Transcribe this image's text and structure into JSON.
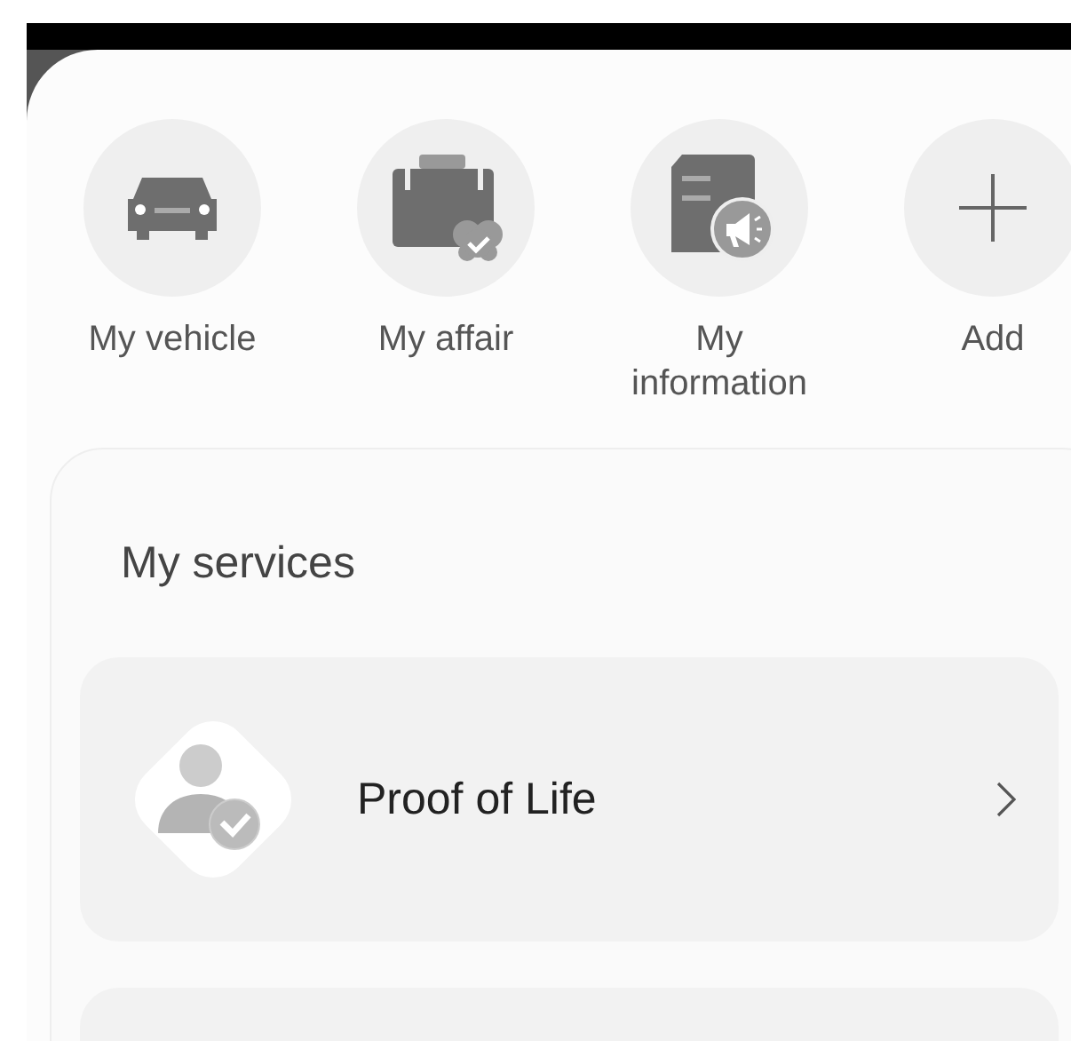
{
  "shortcuts": [
    {
      "label": "My vehicle",
      "kind": "car"
    },
    {
      "label": "My affair",
      "kind": "briefcase"
    },
    {
      "label": "My information",
      "kind": "document"
    },
    {
      "label": "Add",
      "kind": "add"
    }
  ],
  "services": {
    "title": "My services",
    "items": [
      {
        "title": "Proof of Life",
        "kind": "person"
      },
      {
        "kind": "partial"
      }
    ]
  }
}
